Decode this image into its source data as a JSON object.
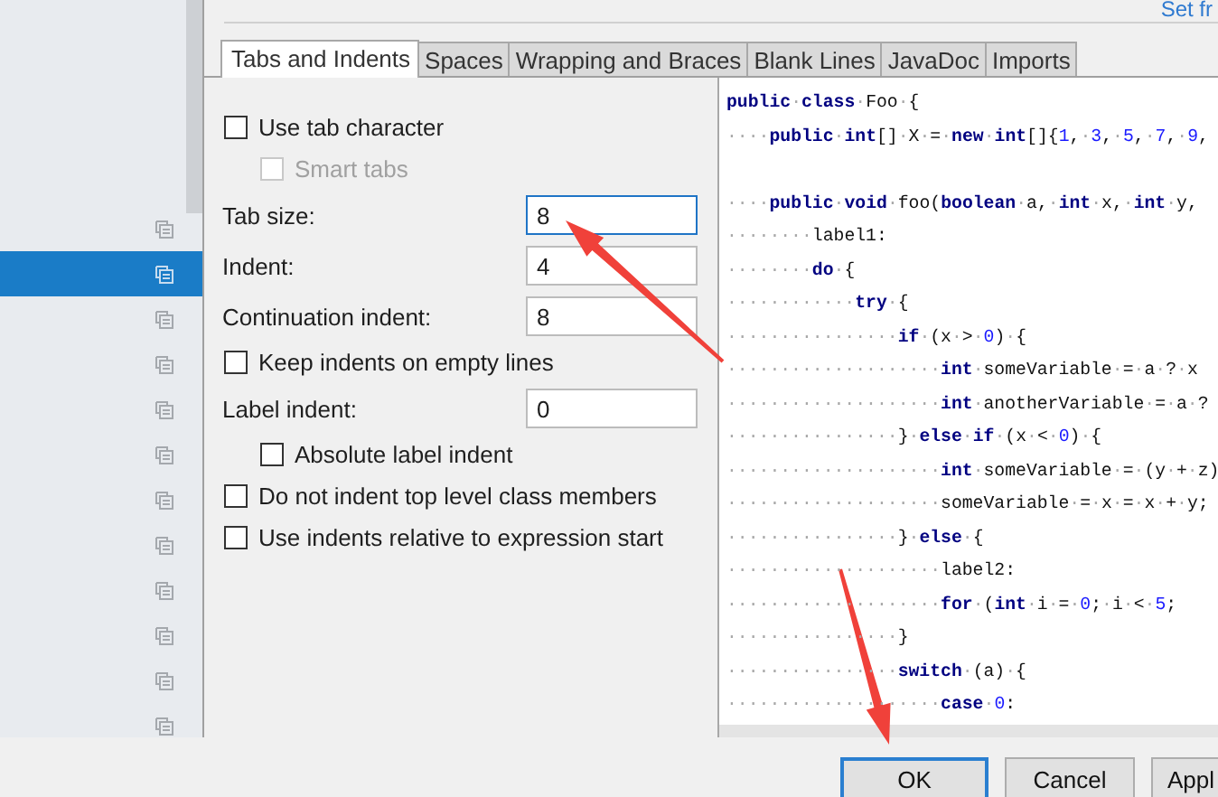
{
  "sidebar": {
    "items": [
      {
        "selected": false
      },
      {
        "selected": true
      },
      {
        "selected": false
      },
      {
        "selected": false
      },
      {
        "selected": false
      },
      {
        "selected": false
      },
      {
        "selected": false
      },
      {
        "selected": false
      },
      {
        "selected": false
      },
      {
        "selected": false
      },
      {
        "selected": false
      },
      {
        "selected": false
      }
    ]
  },
  "header_link": "Set fr",
  "tabs": [
    {
      "label": "Tabs and Indents",
      "selected": true
    },
    {
      "label": "Spaces",
      "selected": false
    },
    {
      "label": "Wrapping and Braces",
      "selected": false
    },
    {
      "label": "Blank Lines",
      "selected": false
    },
    {
      "label": "JavaDoc",
      "selected": false
    },
    {
      "label": "Imports",
      "selected": false
    }
  ],
  "options": [
    {
      "kind": "checkbox",
      "label": "Use tab character",
      "checked": false,
      "disabled": false,
      "children": [
        {
          "kind": "checkbox",
          "label": "Smart tabs",
          "checked": false,
          "disabled": true
        }
      ]
    },
    {
      "kind": "field",
      "label": "Tab size:",
      "value": "8",
      "focused": true
    },
    {
      "kind": "field",
      "label": "Indent:",
      "value": "4",
      "focused": false
    },
    {
      "kind": "field",
      "label": "Continuation indent:",
      "value": "8",
      "focused": false
    },
    {
      "kind": "checkbox",
      "label": "Keep indents on empty lines",
      "checked": false,
      "disabled": false
    },
    {
      "kind": "field",
      "label": "Label indent:",
      "value": "0",
      "focused": false,
      "children": [
        {
          "kind": "checkbox",
          "label": "Absolute label indent",
          "checked": false,
          "disabled": false
        }
      ]
    },
    {
      "kind": "checkbox",
      "label": "Do not indent top level class members",
      "checked": false,
      "disabled": false
    },
    {
      "kind": "checkbox",
      "label": "Use indents relative to expression start",
      "checked": false,
      "disabled": false
    }
  ],
  "code_preview": {
    "lines": [
      {
        "kind": "code",
        "tokens": [
          {
            "kind": "keyword",
            "text": "public"
          },
          {
            "kind": "space",
            "text": "."
          },
          {
            "kind": "keyword",
            "text": "class"
          },
          {
            "kind": "space",
            "text": "."
          },
          {
            "kind": "plain",
            "text": "Foo"
          },
          {
            "kind": "space",
            "text": "."
          },
          {
            "kind": "plain",
            "text": "{"
          }
        ]
      },
      {
        "kind": "code",
        "tokens": [
          {
            "kind": "space",
            "text": "...."
          },
          {
            "kind": "keyword",
            "text": "public"
          },
          {
            "kind": "space",
            "text": "."
          },
          {
            "kind": "keyword",
            "text": "int"
          },
          {
            "kind": "plain",
            "text": "[]"
          },
          {
            "kind": "space",
            "text": "."
          },
          {
            "kind": "plain",
            "text": "X"
          },
          {
            "kind": "space",
            "text": "."
          },
          {
            "kind": "plain",
            "text": "="
          },
          {
            "kind": "space",
            "text": "."
          },
          {
            "kind": "keyword",
            "text": "new"
          },
          {
            "kind": "space",
            "text": "."
          },
          {
            "kind": "keyword",
            "text": "int"
          },
          {
            "kind": "plain",
            "text": "[]{"
          },
          {
            "kind": "number",
            "text": "1"
          },
          {
            "kind": "plain",
            "text": ","
          },
          {
            "kind": "space",
            "text": "."
          },
          {
            "kind": "number",
            "text": "3"
          },
          {
            "kind": "plain",
            "text": ","
          },
          {
            "kind": "space",
            "text": "."
          },
          {
            "kind": "number",
            "text": "5"
          },
          {
            "kind": "plain",
            "text": ","
          },
          {
            "kind": "space",
            "text": "."
          },
          {
            "kind": "number",
            "text": "7"
          },
          {
            "kind": "plain",
            "text": ","
          },
          {
            "kind": "space",
            "text": "."
          },
          {
            "kind": "number",
            "text": "9"
          },
          {
            "kind": "plain",
            "text": ","
          }
        ]
      },
      {
        "kind": "blank"
      },
      {
        "kind": "code",
        "tokens": [
          {
            "kind": "space",
            "text": "...."
          },
          {
            "kind": "keyword",
            "text": "public"
          },
          {
            "kind": "space",
            "text": "."
          },
          {
            "kind": "keyword",
            "text": "void"
          },
          {
            "kind": "space",
            "text": "."
          },
          {
            "kind": "plain",
            "text": "foo("
          },
          {
            "kind": "keyword",
            "text": "boolean"
          },
          {
            "kind": "space",
            "text": "."
          },
          {
            "kind": "plain",
            "text": "a,"
          },
          {
            "kind": "space",
            "text": "."
          },
          {
            "kind": "keyword",
            "text": "int"
          },
          {
            "kind": "space",
            "text": "."
          },
          {
            "kind": "plain",
            "text": "x,"
          },
          {
            "kind": "space",
            "text": "."
          },
          {
            "kind": "keyword",
            "text": "int"
          },
          {
            "kind": "space",
            "text": "."
          },
          {
            "kind": "plain",
            "text": "y,"
          }
        ]
      },
      {
        "kind": "code",
        "tokens": [
          {
            "kind": "space",
            "text": "........"
          },
          {
            "kind": "plain",
            "text": "label1:"
          }
        ]
      },
      {
        "kind": "code",
        "tokens": [
          {
            "kind": "space",
            "text": "........"
          },
          {
            "kind": "keyword",
            "text": "do"
          },
          {
            "kind": "space",
            "text": "."
          },
          {
            "kind": "plain",
            "text": "{"
          }
        ]
      },
      {
        "kind": "code",
        "tokens": [
          {
            "kind": "space",
            "text": "............"
          },
          {
            "kind": "keyword",
            "text": "try"
          },
          {
            "kind": "space",
            "text": "."
          },
          {
            "kind": "plain",
            "text": "{"
          }
        ]
      },
      {
        "kind": "code",
        "tokens": [
          {
            "kind": "space",
            "text": "................"
          },
          {
            "kind": "keyword",
            "text": "if"
          },
          {
            "kind": "space",
            "text": "."
          },
          {
            "kind": "plain",
            "text": "(x"
          },
          {
            "kind": "space",
            "text": "."
          },
          {
            "kind": "plain",
            "text": ">"
          },
          {
            "kind": "space",
            "text": "."
          },
          {
            "kind": "number",
            "text": "0"
          },
          {
            "kind": "plain",
            "text": ")"
          },
          {
            "kind": "space",
            "text": "."
          },
          {
            "kind": "plain",
            "text": "{"
          }
        ]
      },
      {
        "kind": "code",
        "tokens": [
          {
            "kind": "space",
            "text": "...................."
          },
          {
            "kind": "keyword",
            "text": "int"
          },
          {
            "kind": "space",
            "text": "."
          },
          {
            "kind": "plain",
            "text": "someVariable"
          },
          {
            "kind": "space",
            "text": "."
          },
          {
            "kind": "plain",
            "text": "="
          },
          {
            "kind": "space",
            "text": "."
          },
          {
            "kind": "plain",
            "text": "a"
          },
          {
            "kind": "space",
            "text": "."
          },
          {
            "kind": "plain",
            "text": "?"
          },
          {
            "kind": "space",
            "text": "."
          },
          {
            "kind": "plain",
            "text": "x"
          }
        ]
      },
      {
        "kind": "code",
        "tokens": [
          {
            "kind": "space",
            "text": "...................."
          },
          {
            "kind": "keyword",
            "text": "int"
          },
          {
            "kind": "space",
            "text": "."
          },
          {
            "kind": "plain",
            "text": "anotherVariable"
          },
          {
            "kind": "space",
            "text": "."
          },
          {
            "kind": "plain",
            "text": "="
          },
          {
            "kind": "space",
            "text": "."
          },
          {
            "kind": "plain",
            "text": "a"
          },
          {
            "kind": "space",
            "text": "."
          },
          {
            "kind": "plain",
            "text": "?"
          }
        ]
      },
      {
        "kind": "code",
        "tokens": [
          {
            "kind": "space",
            "text": "................"
          },
          {
            "kind": "plain",
            "text": "}"
          },
          {
            "kind": "space",
            "text": "."
          },
          {
            "kind": "keyword",
            "text": "else"
          },
          {
            "kind": "space",
            "text": "."
          },
          {
            "kind": "keyword",
            "text": "if"
          },
          {
            "kind": "space",
            "text": "."
          },
          {
            "kind": "plain",
            "text": "(x"
          },
          {
            "kind": "space",
            "text": "."
          },
          {
            "kind": "plain",
            "text": "<"
          },
          {
            "kind": "space",
            "text": "."
          },
          {
            "kind": "number",
            "text": "0"
          },
          {
            "kind": "plain",
            "text": ")"
          },
          {
            "kind": "space",
            "text": "."
          },
          {
            "kind": "plain",
            "text": "{"
          }
        ]
      },
      {
        "kind": "code",
        "tokens": [
          {
            "kind": "space",
            "text": "...................."
          },
          {
            "kind": "keyword",
            "text": "int"
          },
          {
            "kind": "space",
            "text": "."
          },
          {
            "kind": "plain",
            "text": "someVariable"
          },
          {
            "kind": "space",
            "text": "."
          },
          {
            "kind": "plain",
            "text": "="
          },
          {
            "kind": "space",
            "text": "."
          },
          {
            "kind": "plain",
            "text": "(y"
          },
          {
            "kind": "space",
            "text": "."
          },
          {
            "kind": "plain",
            "text": "+"
          },
          {
            "kind": "space",
            "text": "."
          },
          {
            "kind": "plain",
            "text": "z)"
          }
        ]
      },
      {
        "kind": "code",
        "tokens": [
          {
            "kind": "space",
            "text": "...................."
          },
          {
            "kind": "plain",
            "text": "someVariable"
          },
          {
            "kind": "space",
            "text": "."
          },
          {
            "kind": "plain",
            "text": "="
          },
          {
            "kind": "space",
            "text": "."
          },
          {
            "kind": "plain",
            "text": "x"
          },
          {
            "kind": "space",
            "text": "."
          },
          {
            "kind": "plain",
            "text": "="
          },
          {
            "kind": "space",
            "text": "."
          },
          {
            "kind": "plain",
            "text": "x"
          },
          {
            "kind": "space",
            "text": "."
          },
          {
            "kind": "plain",
            "text": "+"
          },
          {
            "kind": "space",
            "text": "."
          },
          {
            "kind": "plain",
            "text": "y;"
          }
        ]
      },
      {
        "kind": "code",
        "tokens": [
          {
            "kind": "space",
            "text": "................"
          },
          {
            "kind": "plain",
            "text": "}"
          },
          {
            "kind": "space",
            "text": "."
          },
          {
            "kind": "keyword",
            "text": "else"
          },
          {
            "kind": "space",
            "text": "."
          },
          {
            "kind": "plain",
            "text": "{"
          }
        ]
      },
      {
        "kind": "code",
        "tokens": [
          {
            "kind": "space",
            "text": "...................."
          },
          {
            "kind": "plain",
            "text": "label2:"
          }
        ]
      },
      {
        "kind": "code",
        "tokens": [
          {
            "kind": "space",
            "text": "...................."
          },
          {
            "kind": "keyword",
            "text": "for"
          },
          {
            "kind": "space",
            "text": "."
          },
          {
            "kind": "plain",
            "text": "("
          },
          {
            "kind": "keyword",
            "text": "int"
          },
          {
            "kind": "space",
            "text": "."
          },
          {
            "kind": "plain",
            "text": "i"
          },
          {
            "kind": "space",
            "text": "."
          },
          {
            "kind": "plain",
            "text": "="
          },
          {
            "kind": "space",
            "text": "."
          },
          {
            "kind": "number",
            "text": "0"
          },
          {
            "kind": "plain",
            "text": ";"
          },
          {
            "kind": "space",
            "text": "."
          },
          {
            "kind": "plain",
            "text": "i"
          },
          {
            "kind": "space",
            "text": "."
          },
          {
            "kind": "plain",
            "text": "<"
          },
          {
            "kind": "space",
            "text": "."
          },
          {
            "kind": "number",
            "text": "5"
          },
          {
            "kind": "plain",
            "text": ";"
          }
        ]
      },
      {
        "kind": "code",
        "tokens": [
          {
            "kind": "space",
            "text": "................"
          },
          {
            "kind": "plain",
            "text": "}"
          }
        ]
      },
      {
        "kind": "code",
        "tokens": [
          {
            "kind": "space",
            "text": "................"
          },
          {
            "kind": "keyword",
            "text": "switch"
          },
          {
            "kind": "space",
            "text": "."
          },
          {
            "kind": "plain",
            "text": "(a)"
          },
          {
            "kind": "space",
            "text": "."
          },
          {
            "kind": "plain",
            "text": "{"
          }
        ]
      },
      {
        "kind": "code",
        "tokens": [
          {
            "kind": "space",
            "text": "...................."
          },
          {
            "kind": "keyword",
            "text": "case"
          },
          {
            "kind": "space",
            "text": "."
          },
          {
            "kind": "number",
            "text": "0"
          },
          {
            "kind": "plain",
            "text": ":"
          }
        ]
      }
    ]
  },
  "buttons": [
    {
      "label": "OK",
      "default": true
    },
    {
      "label": "Cancel",
      "default": false
    },
    {
      "label": "Appl",
      "default": false
    }
  ],
  "annotations": [
    {
      "kind": "arrow"
    },
    {
      "kind": "arrow"
    }
  ]
}
